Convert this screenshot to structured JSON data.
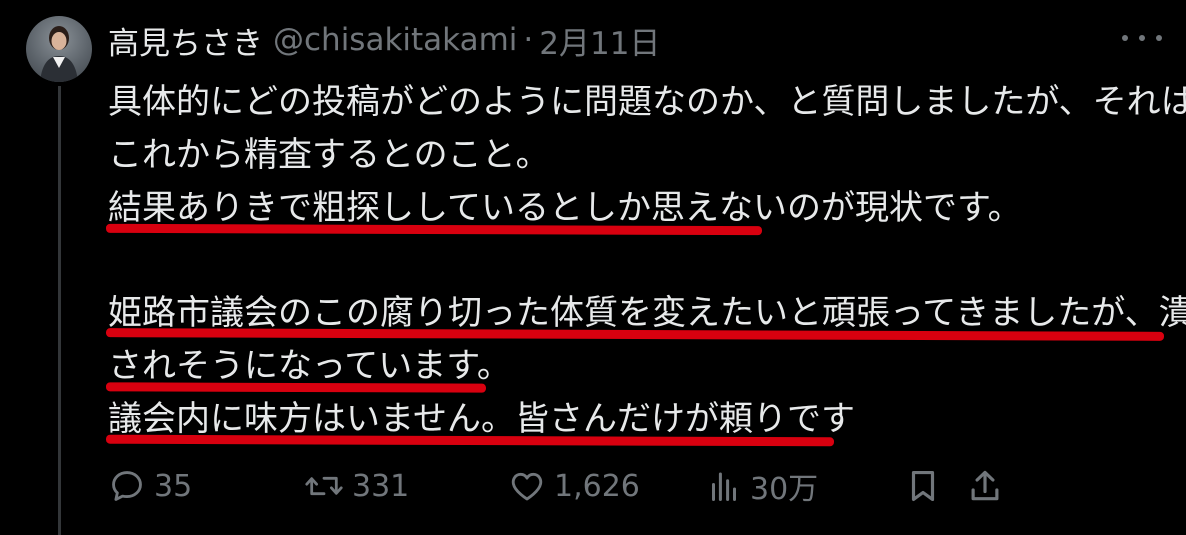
{
  "post": {
    "display_name": "高見ちさき",
    "handle": "@chisakitakami",
    "separator": "·",
    "date": "2月11日",
    "lines": [
      "具体的にどの投稿がどのように問題なのか、と質問しましたが、それは",
      "これから精査するとのこと。",
      "結果ありきで粗探ししているとしか思えないのが現状です。",
      "",
      "姫路市議会のこの腐り切った体質を変えたいと頑張ってきましたが、潰",
      "されそうになっています。",
      "議会内に味方はいません。皆さんだけが頼りです"
    ]
  },
  "actions": {
    "reply_count": "35",
    "repost_count": "331",
    "like_count": "1,626",
    "view_count": "30万"
  },
  "icons": {
    "reply": "reply-bubble-icon",
    "repost": "repost-arrows-icon",
    "like": "heart-icon",
    "views": "bar-chart-icon",
    "bookmark": "bookmark-icon",
    "share": "share-upload-icon",
    "more": "more-dots-icon"
  },
  "colors": {
    "background": "#000000",
    "text": "#e7e9ea",
    "muted": "#71767b",
    "underline": "#d8000f"
  }
}
